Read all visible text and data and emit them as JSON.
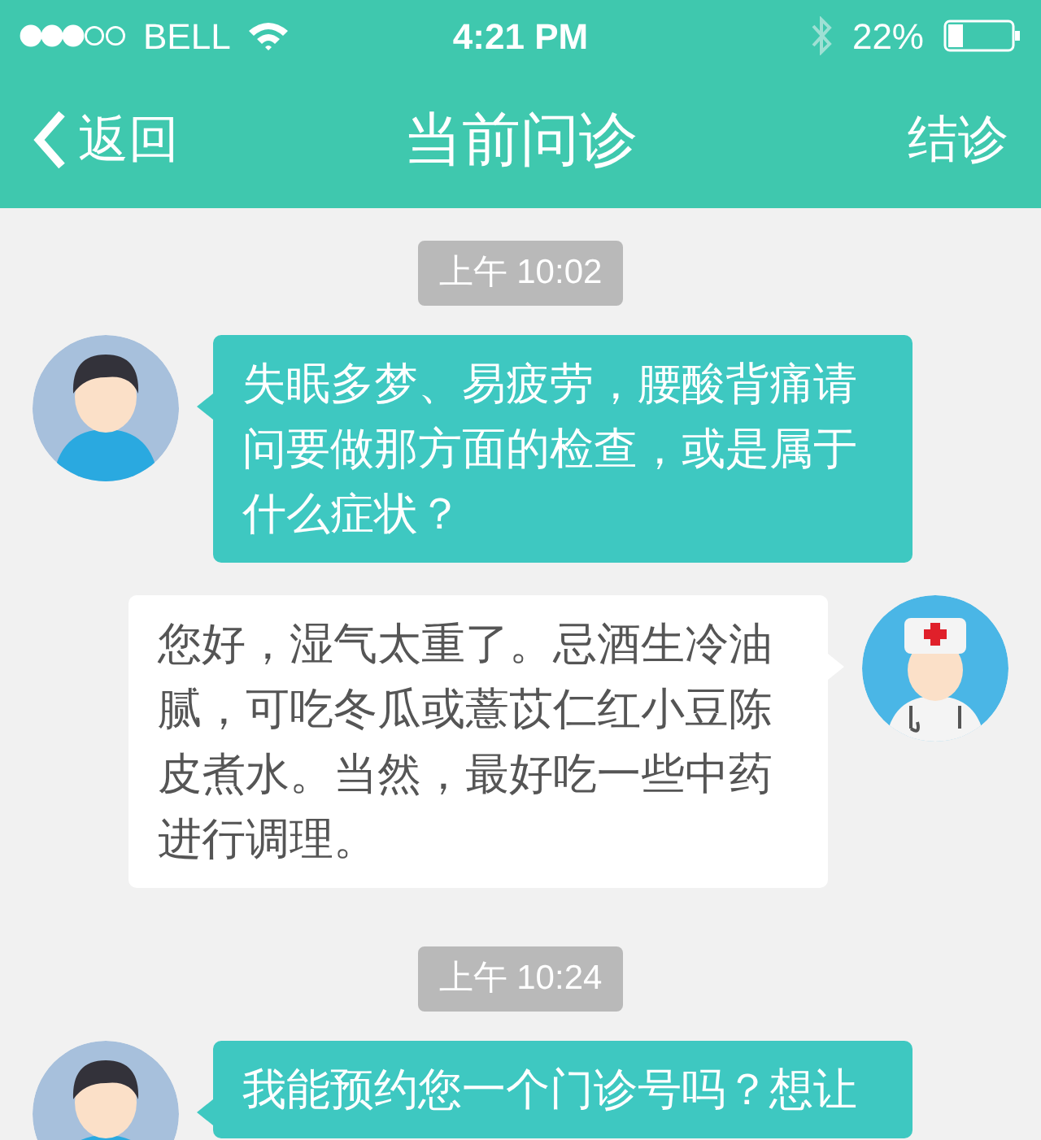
{
  "status_bar": {
    "carrier": "BELL",
    "time": "4:21 PM",
    "battery": "22%"
  },
  "nav": {
    "back": "返回",
    "title": "当前问诊",
    "action": "结诊"
  },
  "messages": [
    {
      "kind": "time",
      "text": "上午 10:02"
    },
    {
      "kind": "patient",
      "text": "失眠多梦、易疲劳，腰酸背痛请问要做那方面的检查，或是属于什么症状？"
    },
    {
      "kind": "doctor",
      "text": "您好，湿气太重了。忌酒生冷油腻，可吃冬瓜或薏苡仁红小豆陈皮煮水。当然，最好吃一些中药进行调理。"
    },
    {
      "kind": "time",
      "text": "上午 10:24"
    },
    {
      "kind": "patient",
      "text": "我能预约您一个门诊号吗？想让"
    }
  ]
}
